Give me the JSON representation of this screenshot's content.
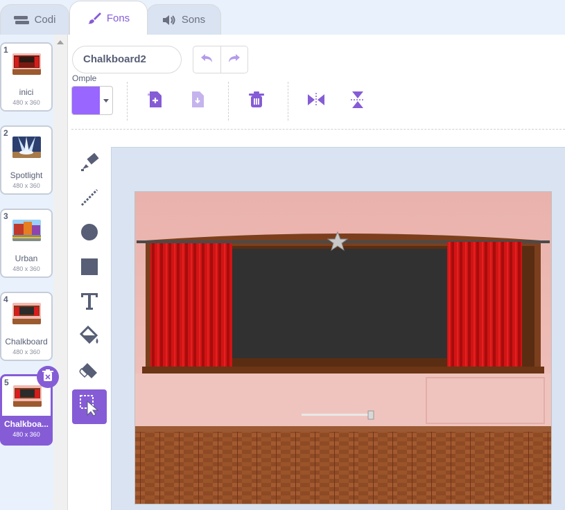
{
  "tabs": [
    {
      "label": "Codi",
      "icon": "code-icon"
    },
    {
      "label": "Fons",
      "icon": "paintbrush-icon"
    },
    {
      "label": "Sons",
      "icon": "speaker-icon"
    }
  ],
  "backdrops": [
    {
      "number": "1",
      "name": "inici",
      "dims": "480 x 360"
    },
    {
      "number": "2",
      "name": "Spotlight",
      "dims": "480 x 360"
    },
    {
      "number": "3",
      "name": "Urban",
      "dims": "480 x 360"
    },
    {
      "number": "4",
      "name": "Chalkboard",
      "dims": "480 x 360"
    },
    {
      "number": "5",
      "name": "Chalkboa...",
      "dims": "480 x 360"
    }
  ],
  "editor": {
    "costume_name": "Chalkboard2",
    "fill_label": "Omple",
    "fill_color": "#9966ff"
  },
  "colors": {
    "accent": "#855cd6",
    "accent_light": "#b49bea",
    "panel_bg": "#e9f1fc",
    "canvas_bg": "#d9e3f2"
  }
}
